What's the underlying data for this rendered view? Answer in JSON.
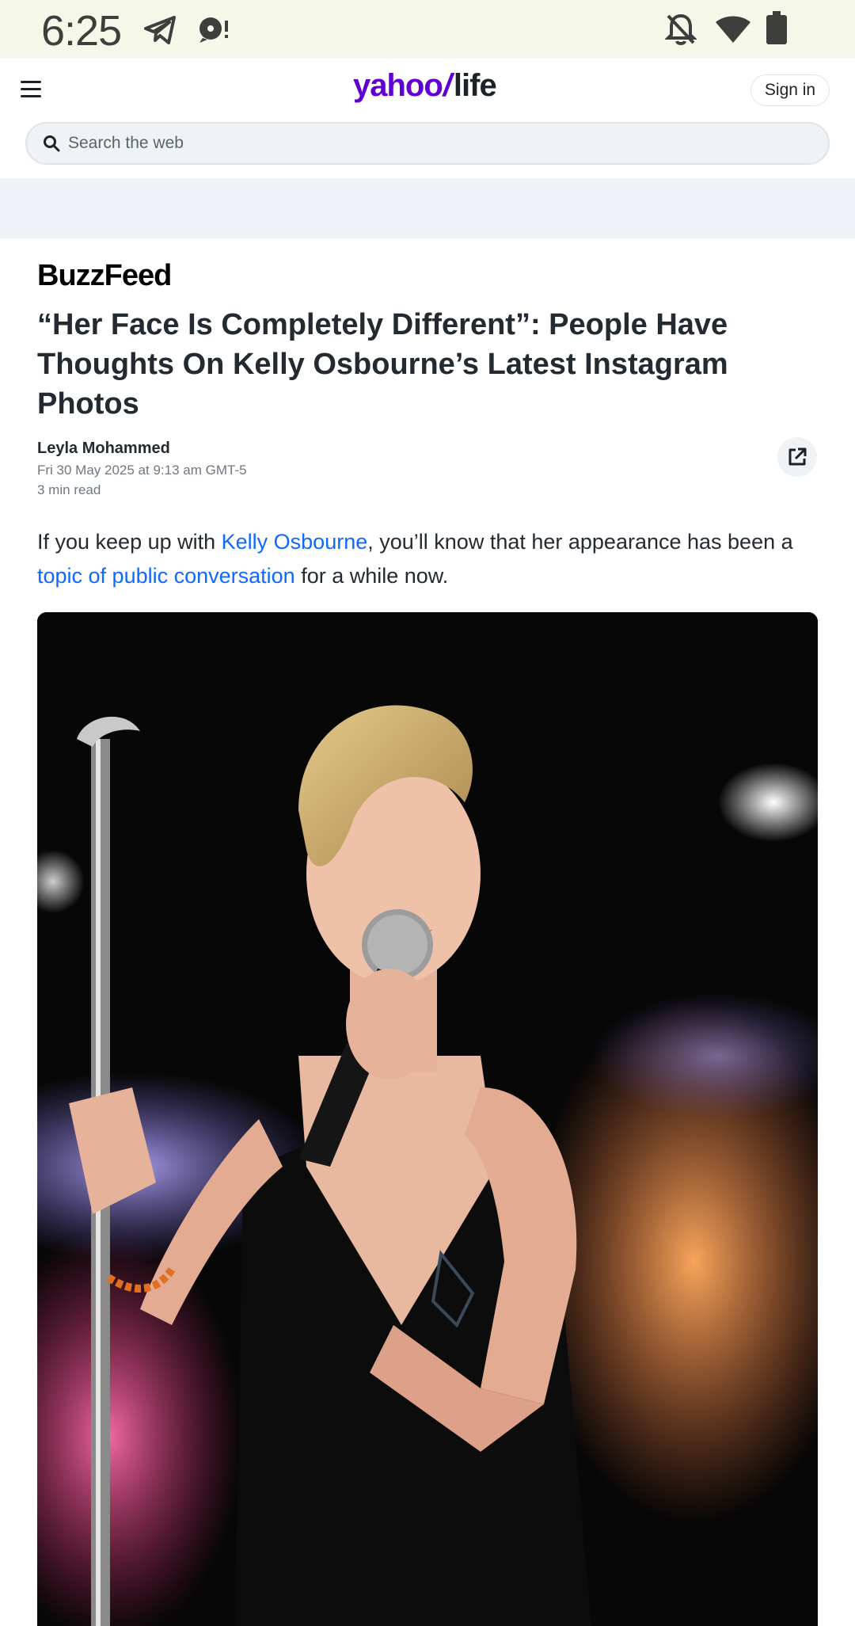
{
  "status_bar": {
    "time": "6:25",
    "icons": [
      "telegram-icon",
      "podcast-icon",
      "bell-off-icon",
      "wifi-icon",
      "battery-icon"
    ]
  },
  "header": {
    "logo_yahoo": "yahoo",
    "logo_bang": "/",
    "logo_life": "life",
    "signin_label": "Sign in"
  },
  "search": {
    "placeholder": "Search the web"
  },
  "article": {
    "publisher": "BuzzFeed",
    "headline": "“Her Face Is Completely Different”: People Have Thoughts On Kelly Osbourne’s Latest Instagram Photos",
    "author": "Leyla Mohammed",
    "date": "Fri 30 May 2025 at 9:13 am GMT-5",
    "read_time": "3 min read",
    "paragraph": {
      "part1": "If you keep up with ",
      "link1": "Kelly Osbourne",
      "part2": ", you’ll know that her appearance has been a ",
      "link2": "topic of public conversation",
      "part3": " for a while now."
    }
  },
  "colors": {
    "brand_purple": "#6001d2",
    "link_blue": "#0f69ff",
    "status_bg": "#f5f8e9"
  }
}
